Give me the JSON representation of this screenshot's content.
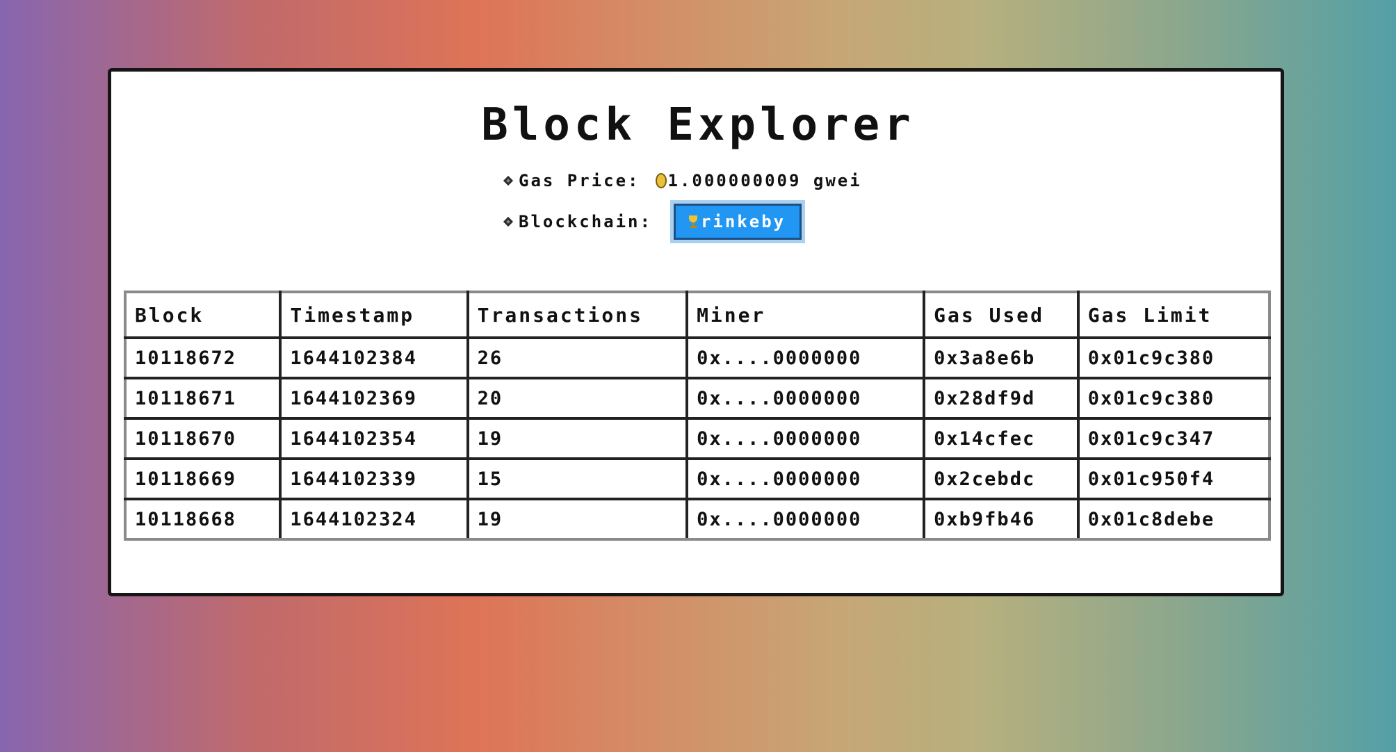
{
  "page": {
    "title": "Block Explorer"
  },
  "info": {
    "gas_price_label": "Gas Price:",
    "gas_price_value": "1.000000009 gwei",
    "blockchain_label": "Blockchain:",
    "blockchain_button": "rinkeby"
  },
  "table": {
    "headers": [
      "Block",
      "Timestamp",
      "Transactions",
      "Miner",
      "Gas Used",
      "Gas Limit"
    ],
    "rows": [
      [
        "10118672",
        "1644102384",
        "26",
        "0x....0000000",
        "0x3a8e6b",
        "0x01c9c380"
      ],
      [
        "10118671",
        "1644102369",
        "20",
        "0x....0000000",
        "0x28df9d",
        "0x01c9c380"
      ],
      [
        "10118670",
        "1644102354",
        "19",
        "0x....0000000",
        "0x14cfec",
        "0x01c9c347"
      ],
      [
        "10118669",
        "1644102339",
        "15",
        "0x....0000000",
        "0x2cebdc",
        "0x01c950f4"
      ],
      [
        "10118668",
        "1644102324",
        "19",
        "0x....0000000",
        "0xb9fb46",
        "0x01c8debe"
      ]
    ]
  },
  "icons": {
    "bullet": "diamond-bullet-icon",
    "gas_price": "coin-icon",
    "blockchain": "trophy-icon"
  },
  "colors": {
    "button_bg": "#2196f3",
    "button_border": "#1c4f86",
    "button_halo": "#a9d0ee"
  }
}
